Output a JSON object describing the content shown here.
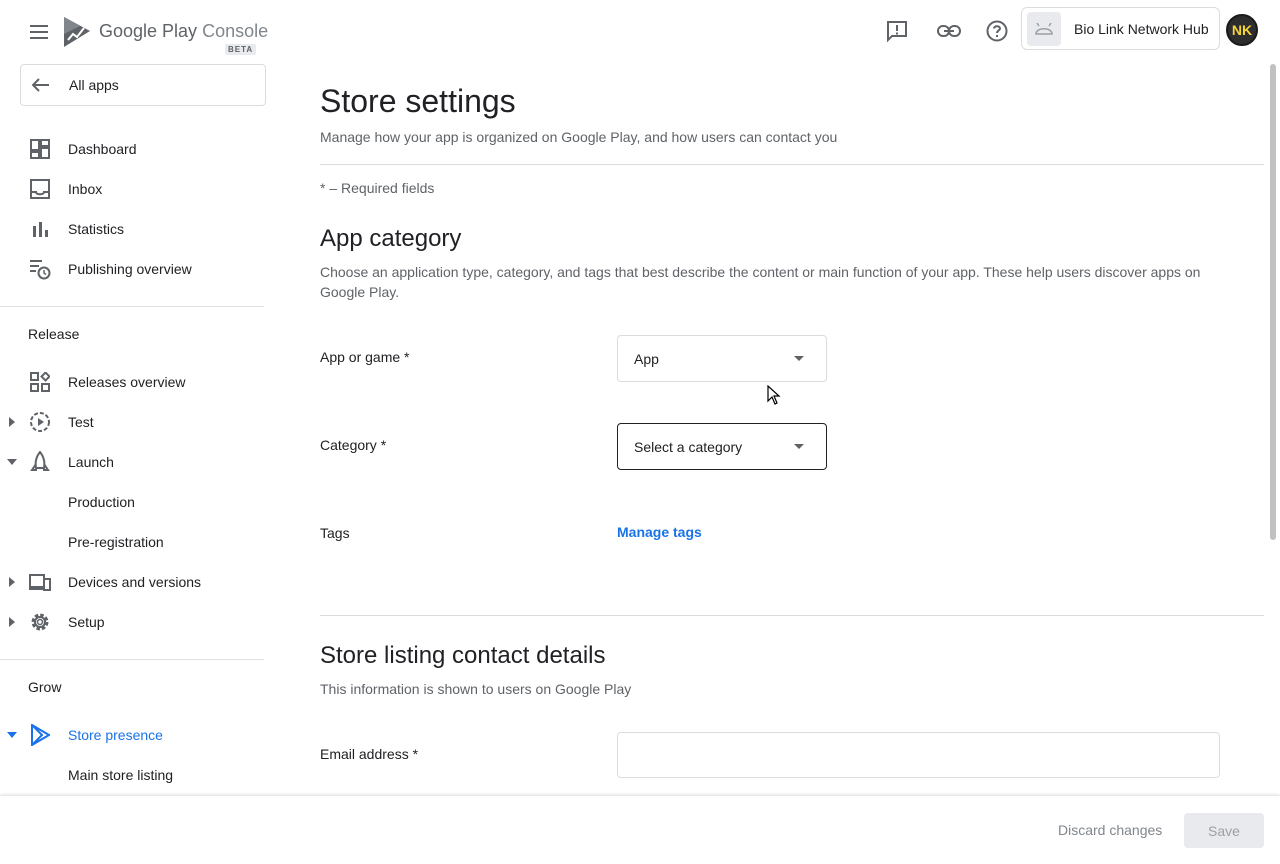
{
  "topbar": {
    "brand_primary": "Google Play",
    "brand_secondary": "Console",
    "beta": "BETA",
    "account_name": "Bio Link Network Hub",
    "avatar_initials": "NK",
    "icons": [
      "menu-icon",
      "feedback-icon",
      "link-icon",
      "help-icon",
      "android-icon"
    ]
  },
  "sidebar": {
    "all_apps": "All apps",
    "items": [
      {
        "label": "Dashboard",
        "icon": "dashboard-icon"
      },
      {
        "label": "Inbox",
        "icon": "inbox-icon"
      },
      {
        "label": "Statistics",
        "icon": "bar-chart-icon"
      },
      {
        "label": "Publishing overview",
        "icon": "publishing-icon"
      }
    ],
    "release_title": "Release",
    "release_items": [
      {
        "label": "Releases overview",
        "icon": "releases-icon"
      },
      {
        "label": "Test",
        "icon": "test-icon"
      },
      {
        "label": "Launch",
        "icon": "launch-icon"
      },
      {
        "label": "Production"
      },
      {
        "label": "Pre-registration"
      },
      {
        "label": "Devices and versions",
        "icon": "devices-icon"
      },
      {
        "label": "Setup",
        "icon": "gear-icon"
      }
    ],
    "grow_title": "Grow",
    "grow_items": [
      {
        "label": "Store presence",
        "icon": "store-presence-icon",
        "active": true
      },
      {
        "label": "Main store listing"
      }
    ]
  },
  "main": {
    "title": "Store settings",
    "subtitle": "Manage how your app is organized on Google Play, and how users can contact you",
    "required_note": "* – Required fields",
    "app_category": {
      "heading": "App category",
      "description": "Choose an application type, category, and tags that best describe the content or main function of your app. These help users discover apps on Google Play.",
      "app_or_game_label": "App or game  *",
      "app_or_game_value": "App",
      "category_label": "Category  *",
      "category_value": "Select a category",
      "tags_label": "Tags",
      "manage_tags": "Manage tags"
    },
    "contact": {
      "heading": "Store listing contact details",
      "description": "This information is shown to users on Google Play",
      "email_label": "Email address  *",
      "email_value": ""
    }
  },
  "footer": {
    "discard": "Discard changes",
    "save": "Save"
  },
  "colors": {
    "accent": "#1a73e8",
    "text": "#202124",
    "secondary": "#5f6368"
  }
}
